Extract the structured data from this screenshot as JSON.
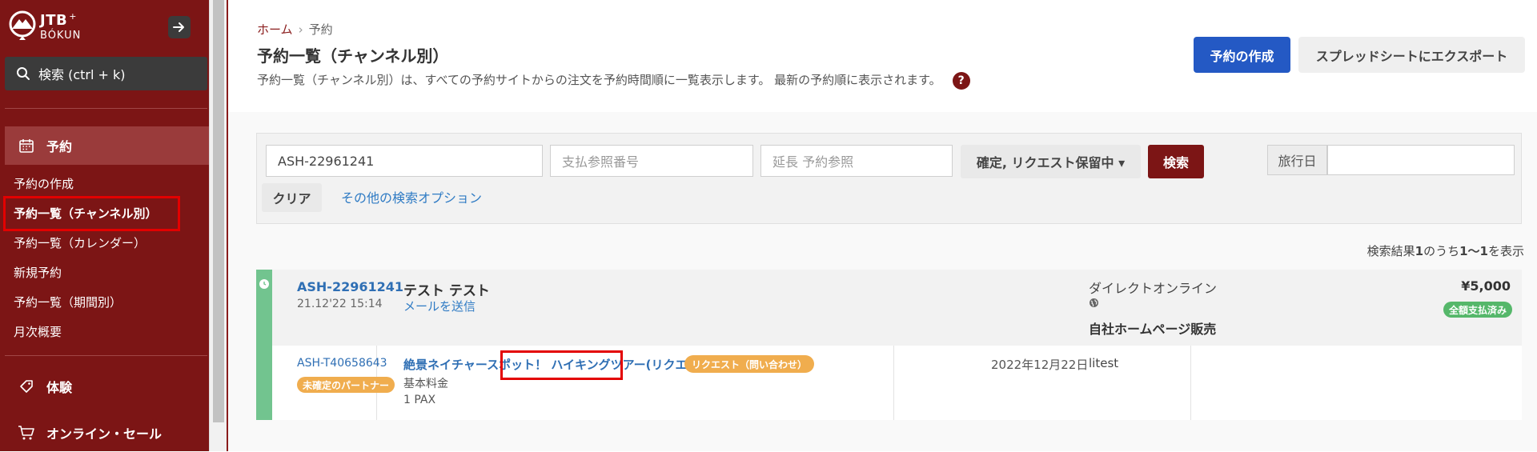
{
  "sidebar": {
    "brand": "JTB",
    "brand_plus": "+",
    "brand_sub": "BÓKUN",
    "search_label": "検索 (ctrl + k)",
    "sections": {
      "booking": "予約",
      "experience": "体験",
      "online_sale": "オンライン・セール"
    },
    "items": [
      {
        "label": "予約の作成"
      },
      {
        "label": "予約一覧（チャンネル別）"
      },
      {
        "label": "予約一覧（カレンダー）"
      },
      {
        "label": "新規予約"
      },
      {
        "label": "予約一覧（期間別）"
      },
      {
        "label": "月次概要"
      }
    ]
  },
  "header": {
    "breadcrumb": {
      "home": "ホーム",
      "separator": "›",
      "current": "予約"
    },
    "title": "予約一覧（チャンネル別）",
    "description": "予約一覧（チャンネル別）は、すべての予約サイトからの注文を予約時間順に一覧表示します。 最新の予約順に表示されます。",
    "help": "?",
    "create_button": "予約の作成",
    "export_button": "スプレッドシートにエクスポート"
  },
  "search": {
    "booking_ref_value": "ASH-22961241",
    "payment_ref_placeholder": "支払参照番号",
    "ext_ref_placeholder": "延長 予約参照",
    "status_dropdown": "確定, リクエスト保留中 ▾",
    "search_button": "検索",
    "travel_date_label": "旅行日",
    "travel_date_value": "",
    "clear_button": "クリア",
    "more_options_link": "その他の検索オプション"
  },
  "results": {
    "prefix": "検索結果",
    "total": "1",
    "middle": "のうち",
    "range": "1〜1",
    "suffix": "を表示"
  },
  "booking": {
    "id": "ASH-22961241",
    "created": "21.12'22 15:14",
    "customer": "テスト テスト",
    "send_mail": "メールを送信",
    "channel": "ダイレクトオンライン",
    "seller": "自社ホームページ販売",
    "price": "¥5,000",
    "payment_status": "全額支払済み",
    "product": {
      "id": "ASH-T40658643",
      "partner_status": "未確定のパートナー",
      "title": "絶景ネイチャースポット！ ハイキングツアー(リクエスト予約)",
      "request_badge": "リクエスト（問い合わせ）",
      "rate": "基本料金",
      "pax": "1 PAX",
      "date": "2022年12月22日",
      "note": "litest"
    }
  },
  "colors": {
    "sidebar_bg": "#7c1515",
    "primary_blue": "#2459c4",
    "search_button": "#7c1515",
    "confirmed_accent": "#72c48f",
    "paid_badge": "#55b76a",
    "pending_badge": "#f0ad4e",
    "highlight": "#e30000"
  }
}
